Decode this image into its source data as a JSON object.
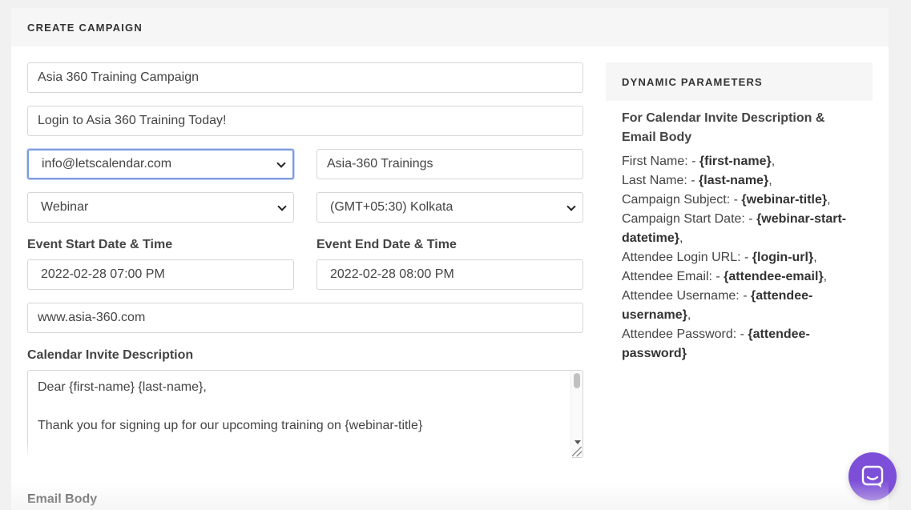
{
  "card": {
    "title": "CREATE CAMPAIGN"
  },
  "form": {
    "campaign_name": "Asia 360 Training Campaign",
    "subject": "Login to Asia 360 Training Today!",
    "from_email": "info@letscalendar.com",
    "from_name": "Asia-360 Trainings",
    "event_type": "Webinar",
    "timezone": "(GMT+05:30) Kolkata",
    "start_label": "Event Start Date & Time",
    "end_label": "Event End Date & Time",
    "start_value": "2022-02-28 07:00 PM",
    "end_value": "2022-02-28 08:00 PM",
    "website": "www.asia-360.com",
    "invite_label": "Calendar Invite Description",
    "invite_text": "Dear {first-name} {last-name},\n\nThank you for signing up for our upcoming training on {webinar-title}",
    "email_body_label": "Email Body"
  },
  "dynamic": {
    "title": "DYNAMIC PARAMETERS",
    "subtitle": "For Calendar Invite Description & Email Body",
    "params": [
      {
        "label": "First Name: - ",
        "token": "{first-name}",
        "sep": ","
      },
      {
        "label": "Last Name: - ",
        "token": "{last-name}",
        "sep": ","
      },
      {
        "label": "Campaign Subject: - ",
        "token": "{webinar-title}",
        "sep": ","
      },
      {
        "label": "Campaign Start Date: - ",
        "token": "{webinar-start-datetime}",
        "sep": ","
      },
      {
        "label": "Attendee Login URL: - ",
        "token": "{login-url}",
        "sep": ","
      },
      {
        "label": "Attendee Email: - ",
        "token": "{attendee-email}",
        "sep": ","
      },
      {
        "label": "Attendee Username: - ",
        "token": "{attendee-username}",
        "sep": ","
      },
      {
        "label": "Attendee Password: - ",
        "token": "{attendee-password}",
        "sep": ""
      }
    ]
  },
  "icons": {
    "chat": "chat-bubble-icon",
    "dropdown": "chevron-down-icon"
  },
  "colors": {
    "chat_button": "#7d4fd8",
    "focus_border": "#7b9ce0"
  }
}
